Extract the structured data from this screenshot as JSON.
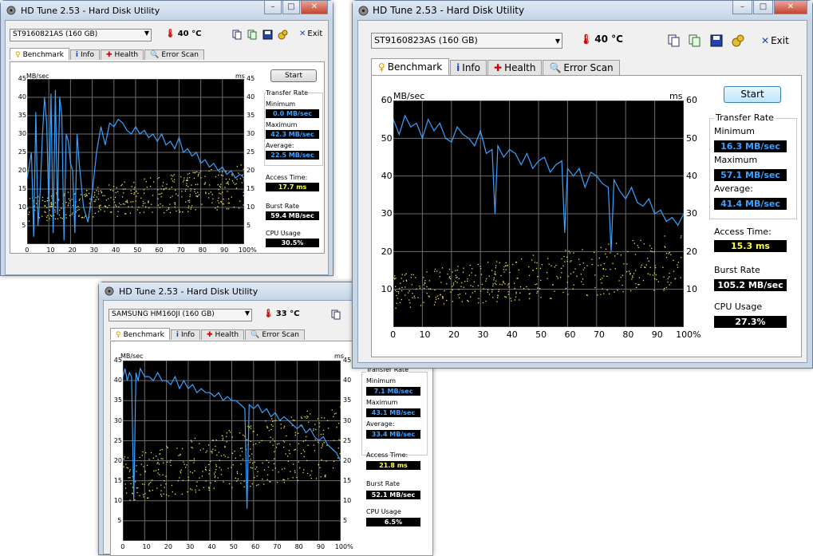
{
  "windows": [
    {
      "id": "w1",
      "title": "HD Tune 2.53 - Hard Disk Utility",
      "drive": "ST9160821AS (160 GB)",
      "temperature": "40 °C",
      "exit_label": "Exit",
      "tabs": [
        "Benchmark",
        "Info",
        "Health",
        "Error Scan"
      ],
      "start_label": "Start",
      "axis": {
        "y_left_unit": "MB/sec",
        "y_right_unit": "ms"
      },
      "stats": {
        "transfer_rate_title": "Transfer Rate",
        "minimum_label": "Minimum",
        "minimum": "0.0 MB/sec",
        "maximum_label": "Maximum",
        "maximum": "42.3 MB/sec",
        "average_label": "Average:",
        "average": "22.5 MB/sec",
        "access_label": "Access Time:",
        "access": "17.7 ms",
        "burst_label": "Burst Rate",
        "burst": "59.4 MB/sec",
        "cpu_label": "CPU Usage",
        "cpu": "30.5%"
      }
    },
    {
      "id": "w2",
      "title": "HD Tune 2.53 - Hard Disk Utility",
      "drive": "SAMSUNG HM160JI (160 GB)",
      "temperature": "33 °C",
      "exit_label": "",
      "tabs": [
        "Benchmark",
        "Info",
        "Health",
        "Error Scan"
      ],
      "start_label": "",
      "axis": {
        "y_left_unit": "MB/sec",
        "y_right_unit": "ms"
      },
      "stats": {
        "transfer_rate_title": "Transfer Rate",
        "minimum_label": "Minimum",
        "minimum": "7.1 MB/sec",
        "maximum_label": "Maximum",
        "maximum": "43.1 MB/sec",
        "average_label": "Average:",
        "average": "33.4 MB/sec",
        "access_label": "Access Time:",
        "access": "21.8 ms",
        "burst_label": "Burst Rate",
        "burst": "52.1 MB/sec",
        "cpu_label": "CPU Usage",
        "cpu": "6.5%"
      }
    },
    {
      "id": "w3",
      "title": "HD Tune 2.53 - Hard Disk Utility",
      "drive": "ST9160823AS (160 GB)",
      "temperature": "40 °C",
      "exit_label": "Exit",
      "tabs": [
        "Benchmark",
        "Info",
        "Health",
        "Error Scan"
      ],
      "start_label": "Start",
      "axis": {
        "y_left_unit": "MB/sec",
        "y_right_unit": "ms"
      },
      "stats": {
        "transfer_rate_title": "Transfer Rate",
        "minimum_label": "Minimum",
        "minimum": "16.3 MB/sec",
        "maximum_label": "Maximum",
        "maximum": "57.1 MB/sec",
        "average_label": "Average:",
        "average": "41.4 MB/sec",
        "access_label": "Access Time:",
        "access": "15.3 ms",
        "burst_label": "Burst Rate",
        "burst": "105.2 MB/sec",
        "cpu_label": "CPU Usage",
        "cpu": "27.3%"
      }
    }
  ],
  "colors": {
    "transfer_line": "#3aa2ff",
    "access_dots": "#e8e850",
    "chart_bg": "#000000",
    "grid": "#6e6e6e"
  },
  "icons": [
    "hd-tune-app-icon",
    "thermometer-icon",
    "copy-text-icon",
    "copy-image-icon",
    "save-icon",
    "options-icon",
    "exit-icon",
    "benchmark-tab-icon",
    "info-tab-icon",
    "health-tab-icon",
    "error-scan-tab-icon"
  ],
  "chart_data": [
    {
      "type": "line",
      "window": "w1",
      "x_ticks": [
        "0",
        "10",
        "20",
        "30",
        "40",
        "50",
        "60",
        "70",
        "80",
        "90",
        "100%"
      ],
      "y_ticks_left": [
        "5",
        "10",
        "15",
        "20",
        "25",
        "30",
        "35",
        "40",
        "45"
      ],
      "y_ticks_right": [
        "5",
        "10",
        "15",
        "20",
        "25",
        "30",
        "35",
        "40",
        "45"
      ],
      "ylim": [
        0,
        45
      ],
      "xlim": [
        0,
        100
      ],
      "series": [
        {
          "values_x": [
            0,
            2,
            3,
            4,
            5,
            6,
            7,
            8,
            9,
            10,
            11,
            12,
            13,
            14,
            15,
            16,
            17,
            18,
            19,
            20,
            21,
            22,
            23,
            24,
            26,
            28,
            30,
            32,
            34,
            36,
            38,
            40,
            42,
            44,
            46,
            48,
            50,
            52,
            54,
            56,
            58,
            60,
            62,
            64,
            66,
            68,
            70,
            72,
            74,
            76,
            78,
            80,
            82,
            84,
            86,
            88,
            90,
            92,
            94,
            96,
            98,
            100
          ],
          "values_y": [
            18,
            25,
            2,
            36,
            5,
            14,
            29,
            40,
            33,
            10,
            41,
            3,
            42,
            8,
            40,
            35,
            1,
            30,
            28,
            22,
            20,
            3,
            30,
            22,
            10,
            6,
            14,
            25,
            32,
            27,
            33,
            32,
            34,
            33,
            31,
            30,
            32,
            30,
            31,
            29,
            30,
            28,
            30,
            27,
            28,
            26,
            29,
            25,
            26,
            24,
            25,
            22,
            23,
            21,
            22,
            20,
            21,
            19,
            20,
            18,
            19,
            18
          ]
        },
        {
          "type": "scatter",
          "note_y_range": [
            6,
            22
          ]
        }
      ]
    },
    {
      "type": "line",
      "window": "w2",
      "x_ticks": [
        "0",
        "10",
        "20",
        "30",
        "40",
        "50",
        "60",
        "70",
        "80",
        "90",
        "100%"
      ],
      "y_ticks_left": [
        "5",
        "10",
        "15",
        "20",
        "25",
        "30",
        "35",
        "40",
        "45"
      ],
      "y_ticks_right": [
        "5",
        "10",
        "15",
        "20",
        "25",
        "30",
        "35",
        "40",
        "45"
      ],
      "ylim": [
        0,
        45
      ],
      "xlim": [
        0,
        100
      ],
      "series": [
        {
          "values_x": [
            0,
            1,
            2,
            3,
            4,
            5,
            6,
            7,
            8,
            10,
            12,
            14,
            16,
            18,
            20,
            22,
            24,
            26,
            28,
            30,
            32,
            34,
            36,
            38,
            40,
            42,
            44,
            46,
            48,
            50,
            52,
            54,
            56,
            57,
            58,
            60,
            62,
            64,
            66,
            68,
            70,
            72,
            74,
            76,
            78,
            80,
            82,
            84,
            86,
            88,
            90,
            92,
            94,
            96,
            98,
            100
          ],
          "values_y": [
            41,
            43,
            40,
            42,
            41,
            10,
            42,
            40,
            43,
            41,
            41,
            40,
            42,
            40,
            40,
            39,
            41,
            38,
            40,
            38,
            39,
            37,
            38,
            37,
            37,
            36,
            37,
            35,
            36,
            35,
            35,
            34,
            33,
            8,
            34,
            33,
            34,
            32,
            33,
            31,
            32,
            30,
            31,
            30,
            29,
            28,
            29,
            27,
            28,
            26,
            25,
            26,
            24,
            23,
            22,
            20
          ]
        },
        {
          "type": "scatter",
          "note_y_range": [
            10,
            35
          ]
        }
      ]
    },
    {
      "type": "line",
      "window": "w3",
      "x_ticks": [
        "0",
        "10",
        "20",
        "30",
        "40",
        "50",
        "60",
        "70",
        "80",
        "90",
        "100%"
      ],
      "y_ticks_left": [
        "10",
        "20",
        "30",
        "40",
        "50",
        "60"
      ],
      "y_ticks_right": [
        "10",
        "20",
        "30",
        "40",
        "50",
        "60"
      ],
      "ylim": [
        0,
        60
      ],
      "xlim": [
        0,
        100
      ],
      "series": [
        {
          "values_x": [
            0,
            2,
            4,
            6,
            8,
            10,
            12,
            14,
            16,
            18,
            20,
            22,
            24,
            26,
            28,
            30,
            32,
            34,
            35,
            36,
            38,
            40,
            42,
            44,
            46,
            48,
            50,
            52,
            54,
            56,
            58,
            59,
            60,
            62,
            64,
            66,
            68,
            70,
            72,
            74,
            75,
            76,
            78,
            80,
            82,
            84,
            86,
            88,
            90,
            92,
            94,
            96,
            98,
            100
          ],
          "values_y": [
            55,
            51,
            56,
            53,
            54,
            50,
            55,
            52,
            54,
            50,
            49,
            53,
            51,
            50,
            48,
            52,
            46,
            47,
            30,
            48,
            45,
            47,
            46,
            43,
            46,
            42,
            44,
            45,
            41,
            43,
            44,
            25,
            42,
            40,
            42,
            37,
            41,
            40,
            38,
            37,
            20,
            39,
            36,
            34,
            37,
            33,
            32,
            34,
            30,
            31,
            28,
            29,
            27,
            30
          ]
        },
        {
          "type": "scatter",
          "note_y_range": [
            5,
            25
          ]
        }
      ]
    }
  ]
}
